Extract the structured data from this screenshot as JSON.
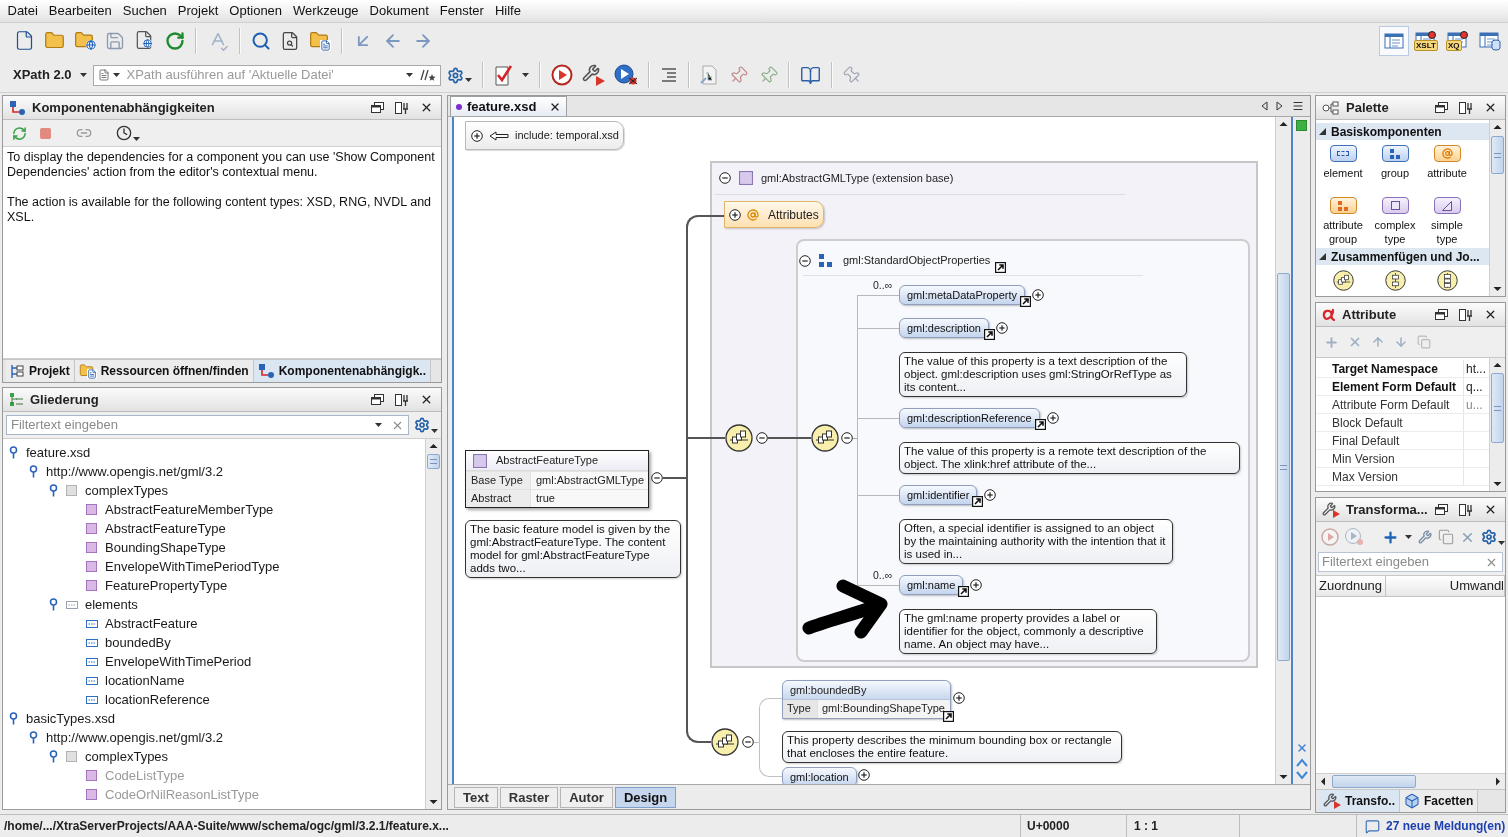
{
  "menu": [
    "Datei",
    "Bearbeiten",
    "Suchen",
    "Projekt",
    "Optionen",
    "Werkzeuge",
    "Dokument",
    "Fenster",
    "Hilfe"
  ],
  "toolbar": {
    "xpath_version": "XPath 2.0",
    "xpath_field": {
      "placeholder": "XPath ausführen auf 'Aktuelle Datei'"
    },
    "perspectives": [
      {
        "kind": "editor",
        "selected": true
      },
      {
        "kind": "xslt_debugger",
        "badge": "XSLT",
        "selected": false
      },
      {
        "kind": "xquery_debugger",
        "badge": "XQ",
        "selected": false
      },
      {
        "kind": "database",
        "selected": false
      }
    ]
  },
  "dependencies_panel": {
    "title": "Komponentenabhängigkeiten",
    "paragraphs": [
      "To display the dependencies for a component you can use 'Show Component Dependencies' action from the editor's contextual menu.",
      "The action is available for the following content types: XSD, RNG, NVDL and XSL."
    ],
    "tabs": [
      {
        "label": "Projekt",
        "kind": "project",
        "selected": false
      },
      {
        "label": "Ressourcen öffnen/finden",
        "kind": "resources",
        "selected": false
      },
      {
        "label": "Komponentenabhängigk..",
        "kind": "dependencies",
        "selected": true
      }
    ]
  },
  "outline_panel": {
    "title": "Gliederung",
    "filter": {
      "placeholder": "Filtertext eingeben"
    },
    "tree": [
      {
        "label": "feature.xsd",
        "expanded": true,
        "children": [
          {
            "label": "http://www.opengis.net/gml/3.2",
            "expanded": true,
            "children": [
              {
                "label": "complexTypes",
                "kind": "complex_group",
                "expanded": true,
                "children": [
                  {
                    "label": "AbstractFeatureMemberType",
                    "kind": "complex_type",
                    "dimmed": false
                  },
                  {
                    "label": "AbstractFeatureType",
                    "kind": "complex_type",
                    "dimmed": false
                  },
                  {
                    "label": "BoundingShapeType",
                    "kind": "complex_type",
                    "dimmed": false
                  },
                  {
                    "label": "EnvelopeWithTimePeriodType",
                    "kind": "complex_type",
                    "dimmed": false
                  },
                  {
                    "label": "FeaturePropertyType",
                    "kind": "complex_type",
                    "dimmed": false
                  }
                ]
              },
              {
                "label": "elements",
                "kind": "element_group",
                "expanded": true,
                "children": [
                  {
                    "label": "AbstractFeature",
                    "kind": "element",
                    "dimmed": false
                  },
                  {
                    "label": "boundedBy",
                    "kind": "element",
                    "dimmed": false
                  },
                  {
                    "label": "EnvelopeWithTimePeriod",
                    "kind": "element",
                    "dimmed": false
                  },
                  {
                    "label": "locationName",
                    "kind": "element",
                    "dimmed": false
                  },
                  {
                    "label": "locationReference",
                    "kind": "element",
                    "dimmed": false
                  }
                ]
              }
            ]
          }
        ]
      },
      {
        "label": "basicTypes.xsd",
        "expanded": true,
        "children": [
          {
            "label": "http://www.opengis.net/gml/3.2",
            "expanded": true,
            "children": [
              {
                "label": "complexTypes",
                "kind": "complex_group",
                "expanded": true,
                "children": [
                  {
                    "label": "CodeListType",
                    "kind": "complex_type",
                    "dimmed": true
                  },
                  {
                    "label": "CodeOrNilReasonListType",
                    "kind": "complex_type",
                    "dimmed": true
                  }
                ]
              }
            ]
          }
        ]
      }
    ]
  },
  "editor": {
    "tab": {
      "label": "feature.xsd",
      "modified": true
    },
    "diagram": {
      "include": {
        "label": "include: temporal.xsd",
        "expanded": false
      },
      "base_type": {
        "label": "gml:AbstractGMLType (extension base)",
        "expanded": true
      },
      "attributes": {
        "label": "Attributes",
        "expanded": false
      },
      "group": {
        "label": "gml:StandardObjectProperties",
        "expanded": true,
        "elements": [
          {
            "name": "gml:metaDataProperty",
            "occurs": "0..∞",
            "expanded": false
          },
          {
            "name": "gml:description",
            "expanded": false,
            "doc": "The value of this property is a text description of the object. gml:description uses gml:StringOrRefType as its content..."
          },
          {
            "name": "gml:descriptionReference",
            "expanded": false,
            "doc": "The value of this property is a remote text description of the object. The xlink:href attribute of the..."
          },
          {
            "name": "gml:identifier",
            "expanded": false,
            "doc": "Often, a special identifier is assigned to an object by the maintaining authority with the intention that it is used in..."
          },
          {
            "name": "gml:name",
            "occurs": "0..∞",
            "expanded": false,
            "doc": "The gml:name property provides a label or identifier for the object, commonly a descriptive name. An object may have..."
          }
        ]
      },
      "type": {
        "name": "AbstractFeatureType",
        "expanded": true,
        "properties": [
          {
            "key": "Base Type",
            "value": "gml:AbstractGMLType"
          },
          {
            "key": "Abstract",
            "value": "true"
          }
        ],
        "doc": "The basic feature model is given by the gml:AbstractFeatureType. The content model for gml:AbstractFeatureType adds two..."
      },
      "sequences": [
        {
          "expanded": true
        },
        {
          "expanded": true
        },
        {
          "expanded": true
        }
      ],
      "bounded_by": {
        "name": "gml:boundedBy",
        "expanded": false,
        "properties": [
          {
            "key": "Type",
            "value": "gml:BoundingShapeType"
          }
        ],
        "doc": "This property describes the minimum bounding box or rectangle that encloses the entire feature."
      },
      "next_element": {
        "name": "gml:location",
        "expanded": false
      }
    },
    "modes": [
      {
        "label": "Text",
        "selected": false
      },
      {
        "label": "Raster",
        "selected": false
      },
      {
        "label": "Autor",
        "selected": false
      },
      {
        "label": "Design",
        "selected": true
      }
    ]
  },
  "palette": {
    "title": "Palette",
    "sections": [
      {
        "title": "Basiskomponenten",
        "expanded": true,
        "items": [
          {
            "label": "element",
            "kind": "element"
          },
          {
            "label": "group",
            "kind": "group"
          },
          {
            "label": "attribute",
            "kind": "attribute"
          },
          {
            "label": "attribute group",
            "kind": "attribute_group"
          },
          {
            "label": "complex type",
            "kind": "complex_type"
          },
          {
            "label": "simple type",
            "kind": "simple_type"
          }
        ]
      },
      {
        "title": "Zusammenfügen und Jo...",
        "expanded": true,
        "items": [
          {
            "kind": "sequence"
          },
          {
            "kind": "choice"
          },
          {
            "kind": "all"
          }
        ]
      }
    ]
  },
  "attribute_panel": {
    "title": "Attribute",
    "rows": [
      {
        "name": "Target Namespace",
        "value": "ht...",
        "set": true
      },
      {
        "name": "Element Form Default",
        "value": "q...",
        "set": true
      },
      {
        "name": "Attribute Form Default",
        "value": "u...",
        "set": false
      },
      {
        "name": "Block Default",
        "set": false
      },
      {
        "name": "Final Default",
        "set": false
      },
      {
        "name": "Min Version",
        "set": false
      },
      {
        "name": "Max Version",
        "set": false
      }
    ]
  },
  "transformation_panel": {
    "title": "Transforma...",
    "filter": {
      "placeholder": "Filtertext eingeben"
    },
    "columns": [
      "Zuordnung",
      "Umwandl"
    ],
    "tabs": [
      {
        "label": "Transfo..",
        "kind": "transformation",
        "selected": true
      },
      {
        "label": "Facetten",
        "kind": "facets",
        "selected": false
      }
    ]
  },
  "status_bar": {
    "path": "/home/.../XtraServerProjects/AAA-Suite/www/schema/ogc/gml/3.2.1/feature.x...",
    "character": "U+0000",
    "position": "1 : 1",
    "messages": "27 neue Meldung(en)"
  }
}
